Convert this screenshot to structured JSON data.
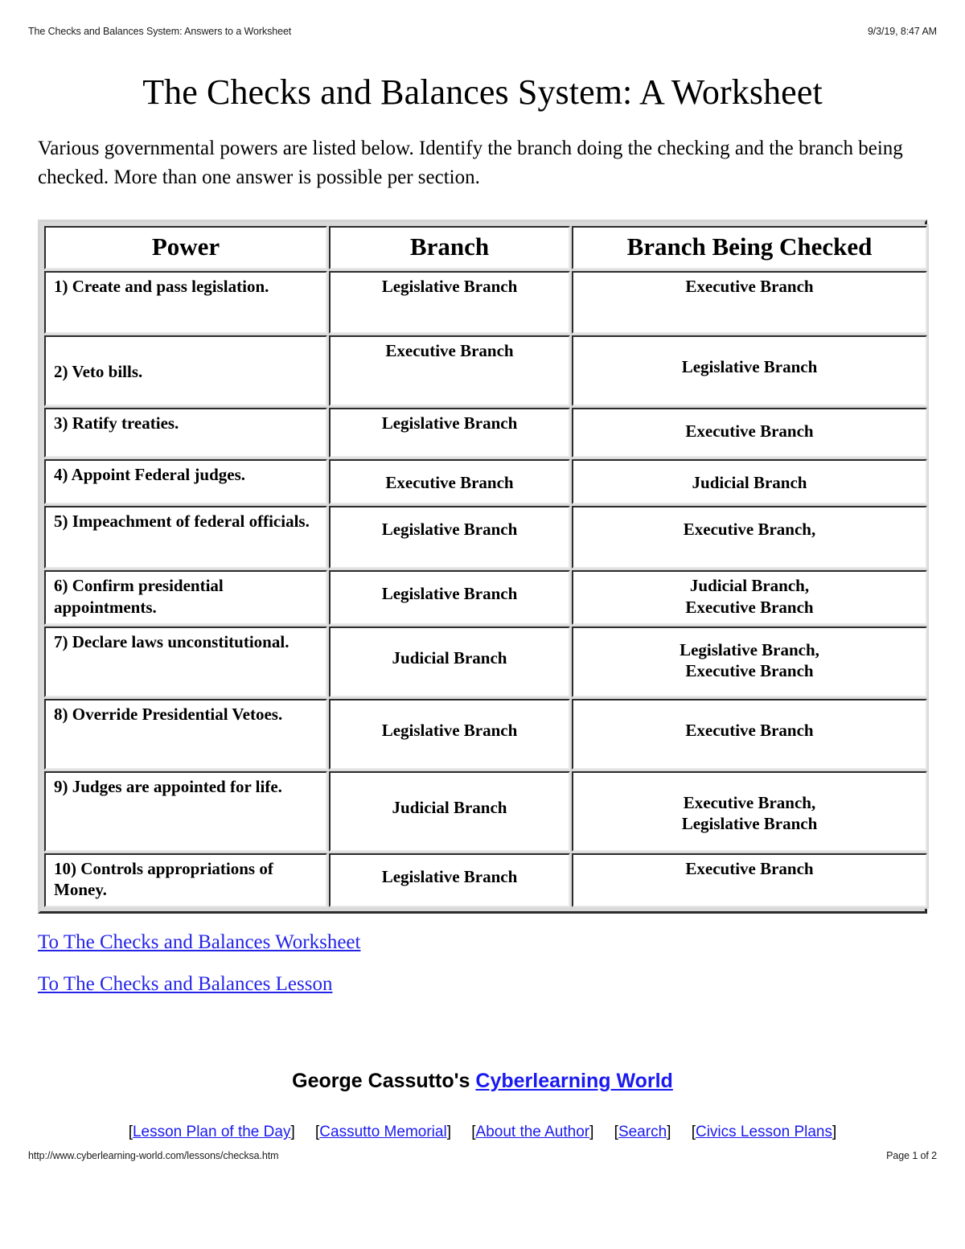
{
  "print_header": {
    "left": "The Checks and Balances System: Answers to a Worksheet",
    "right": "9/3/19, 8:47 AM"
  },
  "print_footer": {
    "url": "http://www.cyberlearning-world.com/lessons/checksa.htm",
    "page": "Page 1 of 2"
  },
  "document": {
    "title": "The Checks and Balances System: A Worksheet",
    "intro": "Various governmental powers are listed below. Identify the branch doing the checking and the branch being checked. More than one answer is possible per section."
  },
  "table": {
    "headers": {
      "power": "Power",
      "branch": "Branch",
      "checked": "Branch Being Checked"
    },
    "rows": [
      {
        "power": "1) Create and pass legislation.",
        "branch": "Legislative Branch",
        "checked": "Executive Branch"
      },
      {
        "power": "2) Veto bills.",
        "branch": "Executive Branch",
        "checked": "Legislative Branch"
      },
      {
        "power": "3) Ratify treaties.",
        "branch": "Legislative Branch",
        "checked": "Executive Branch"
      },
      {
        "power": "4) Appoint Federal judges.",
        "branch": "Executive Branch",
        "checked": "Judicial Branch"
      },
      {
        "power": "5) Impeachment of federal officials.",
        "branch": "Legislative Branch",
        "checked": "Executive Branch,"
      },
      {
        "power": "6) Confirm presidential appointments.",
        "branch": "Legislative Branch",
        "checked_line1": "Judicial Branch,",
        "checked_line2": "Executive Branch"
      },
      {
        "power": "7) Declare laws unconstitutional.",
        "branch": "Judicial Branch",
        "checked_line1": "Legislative Branch,",
        "checked_line2": "Executive Branch"
      },
      {
        "power": "8) Override Presidential Vetoes.",
        "branch": "Legislative Branch",
        "checked": "Executive Branch"
      },
      {
        "power": "9) Judges are appointed for life.",
        "branch": "Judicial Branch",
        "checked_line1": "Executive Branch,",
        "checked_line2": "Legislative Branch"
      },
      {
        "power": "10) Controls appropriations of Money.",
        "branch": "Legislative Branch",
        "checked": "Executive Branch"
      }
    ]
  },
  "links": {
    "worksheet": "To The Checks and Balances Worksheet",
    "lesson": "To The Checks and Balances Lesson"
  },
  "site_footer": {
    "byline_prefix": "George Cassutto's ",
    "byline_link": "Cyberlearning World",
    "nav": [
      "Lesson Plan of the Day",
      "Cassutto Memorial",
      "About the Author",
      "Search",
      "Civics Lesson Plans"
    ],
    "bracket_open": "[",
    "bracket_close": "]"
  },
  "colors": {
    "link": "#2424e8",
    "text": "#000000",
    "table_frame": "#d9d9d9",
    "table_shadow": "#2b2b2b"
  }
}
